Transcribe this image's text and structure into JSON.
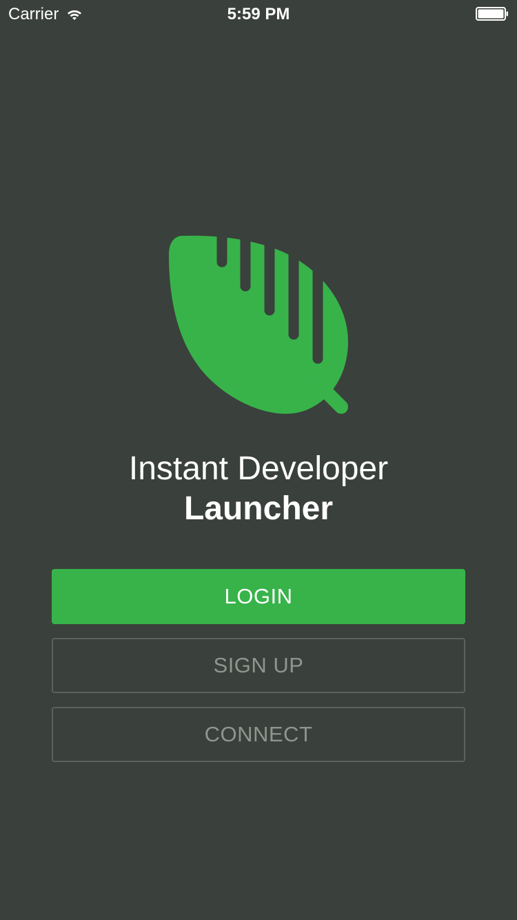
{
  "status_bar": {
    "carrier": "Carrier",
    "time": "5:59 PM",
    "wifi_icon": "wifi-icon",
    "battery_icon": "battery-full-icon"
  },
  "branding": {
    "logo_icon": "leaf-logo-icon",
    "title": "Instant Developer",
    "subtitle": "Launcher",
    "accent_color": "#37b34a",
    "background_color": "#3a403b"
  },
  "actions": {
    "login_label": "LOGIN",
    "signup_label": "SIGN UP",
    "connect_label": "CONNECT"
  }
}
